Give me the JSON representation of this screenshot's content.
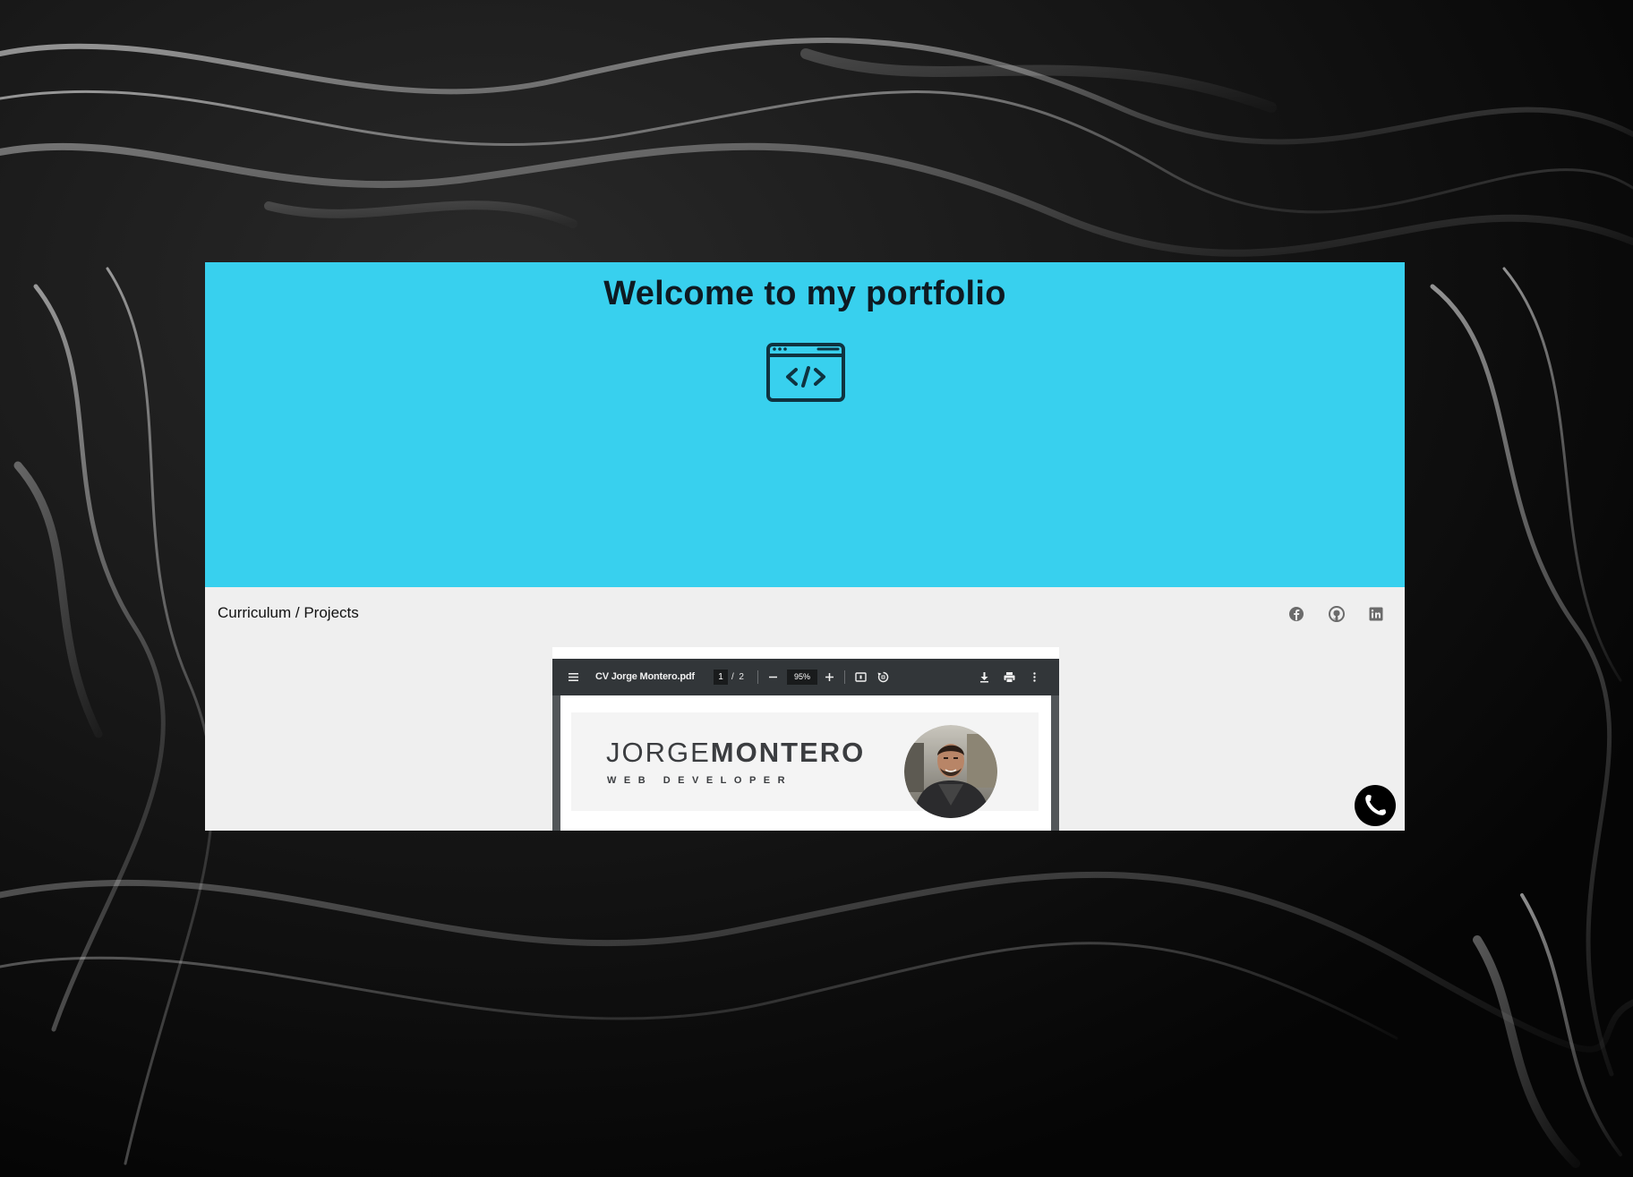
{
  "hero": {
    "title": "Welcome to my portfolio",
    "icon": "code-window-icon",
    "background_color": "#38d0ee"
  },
  "nav": {
    "breadcrumb": "Curriculum / Projects",
    "social_links": [
      {
        "name": "facebook",
        "icon": "facebook-icon"
      },
      {
        "name": "github",
        "icon": "github-icon"
      },
      {
        "name": "linkedin",
        "icon": "linkedin-icon"
      }
    ]
  },
  "pdf_viewer": {
    "file_name": "CV Jorge Montero.pdf",
    "current_page": "1",
    "page_separator": "/",
    "total_pages": "2",
    "zoom": "95%",
    "toolbar_icons": [
      "menu-icon",
      "zoom-out-icon",
      "zoom-in-icon",
      "fit-page-icon",
      "rotate-icon",
      "download-icon",
      "print-icon",
      "more-options-icon"
    ]
  },
  "cv": {
    "first_name": "JORGE",
    "last_name": "MONTERO",
    "role": "WEB DEVELOPER"
  },
  "call_button": {
    "icon": "phone-icon"
  },
  "colors": {
    "hero_accent": "#38d0ee",
    "card_background": "#efefef",
    "pdf_toolbar": "#323639"
  }
}
